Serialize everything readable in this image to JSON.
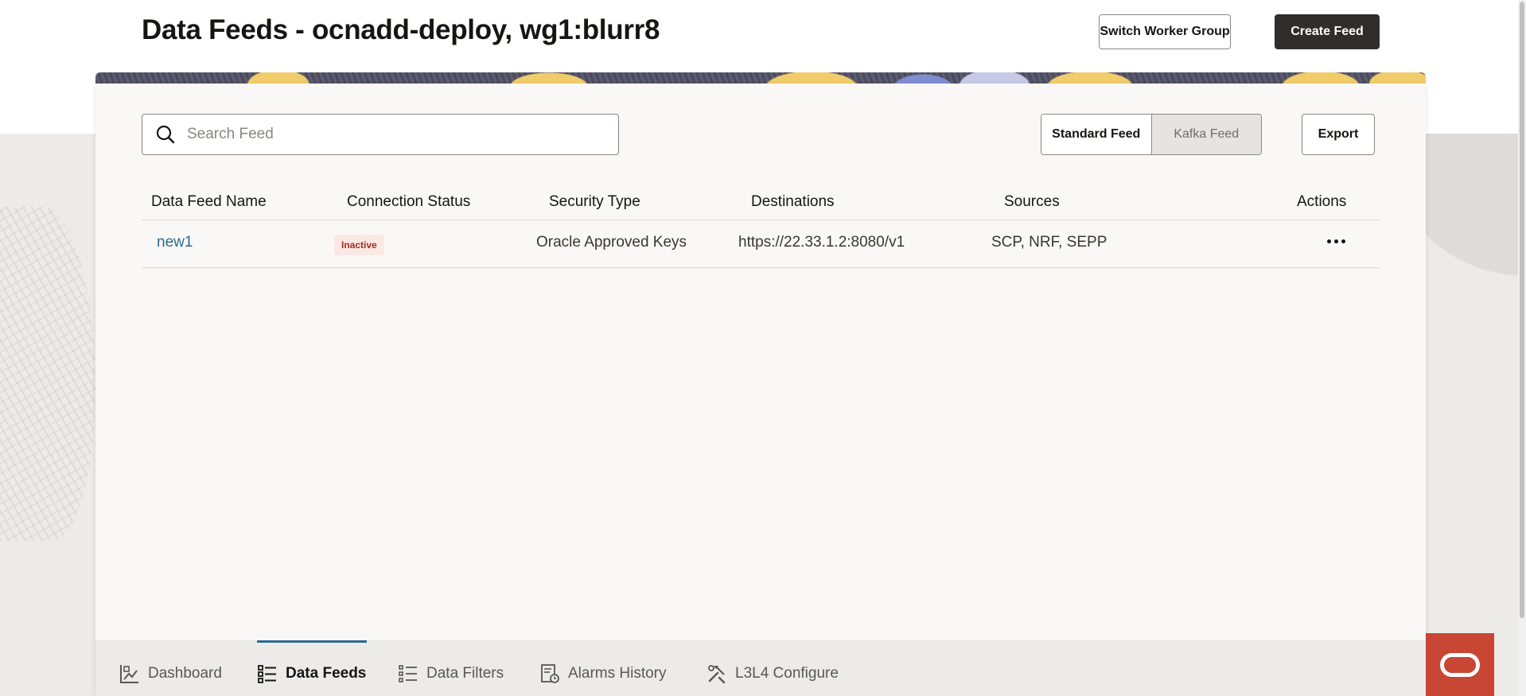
{
  "header": {
    "title": "Data Feeds - ocnadd-deploy, wg1:blurr8",
    "switch_worker_group_label": "Switch Worker Group",
    "create_feed_label": "Create Feed"
  },
  "toolbar": {
    "search_placeholder": "Search Feed",
    "search_value": "",
    "feed_types": [
      {
        "label": "Standard Feed",
        "selected": true
      },
      {
        "label": "Kafka Feed",
        "selected": false
      }
    ],
    "export_label": "Export"
  },
  "table": {
    "columns": [
      "Data Feed Name",
      "Connection Status",
      "Security Type",
      "Destinations",
      "Sources",
      "Actions"
    ],
    "rows": [
      {
        "name": "new1",
        "status": "Inactive",
        "security_type": "Oracle Approved Keys",
        "destinations": "https://22.33.1.2:8080/v1",
        "sources": "SCP, NRF, SEPP"
      }
    ]
  },
  "bottom_nav": {
    "items": [
      {
        "label": "Dashboard",
        "icon": "dashboard-icon",
        "active": false
      },
      {
        "label": "Data Feeds",
        "icon": "data-feeds-icon",
        "active": true
      },
      {
        "label": "Data Filters",
        "icon": "data-filters-icon",
        "active": false
      },
      {
        "label": "Alarms History",
        "icon": "alarms-history-icon",
        "active": false
      },
      {
        "label": "L3L4 Configure",
        "icon": "tools-icon",
        "active": false
      }
    ]
  },
  "colors": {
    "primary_dark": "#312d2a",
    "link": "#2b6a8f",
    "inactive_badge_bg": "#fbe8e4",
    "inactive_badge_text": "#a12e1a",
    "oracle_red": "#c74634"
  },
  "brand_icon": "oracle-logo-icon"
}
